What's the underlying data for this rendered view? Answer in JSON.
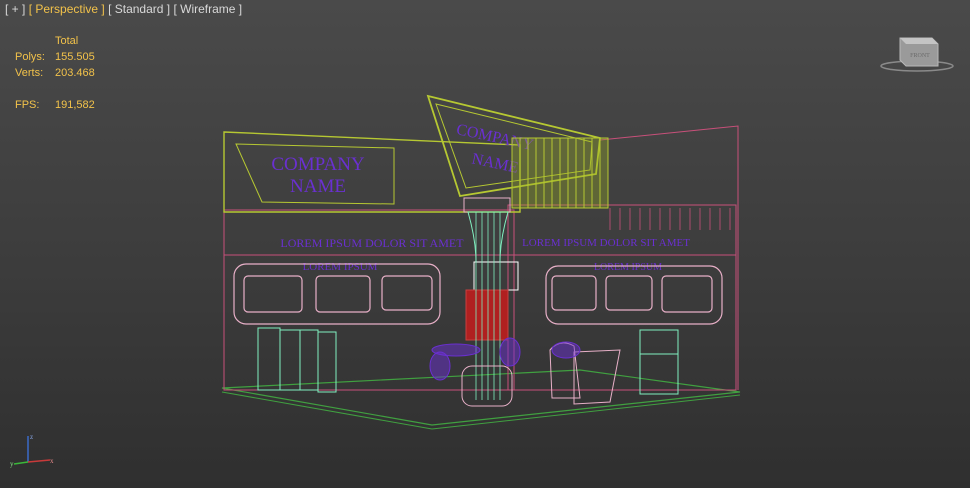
{
  "viewport": {
    "labels": [
      "[ + ]",
      "[ Perspective ]",
      "[ Standard ]",
      "[ Wireframe ]"
    ],
    "stats": {
      "header": "Total",
      "polys_label": "Polys:",
      "polys_value": "155.505",
      "verts_label": "Verts:",
      "verts_value": "203.468",
      "fps_label": "FPS:",
      "fps_value": "191,582"
    },
    "viewcube": {
      "label": "FRONT"
    },
    "axis": {
      "x": "x",
      "y": "y",
      "z": "z"
    }
  },
  "scene": {
    "company_name_line1": "COMPANY",
    "company_name_line2": "NAME",
    "lorem_long": "LOREM IPSUM DOLOR SIT AMET",
    "lorem_short": "LOREM IPSUM"
  },
  "colors": {
    "active_label": "#f2c24a",
    "stat_text": "#f2c24a",
    "wire_yellow": "#b6c832",
    "wire_magenta": "#c8507a",
    "wire_purple": "#6a30d0",
    "wire_pink": "#e8b0c8",
    "wire_cyan": "#80f0c0",
    "wire_green": "#40a040",
    "wire_red": "#b02020"
  }
}
